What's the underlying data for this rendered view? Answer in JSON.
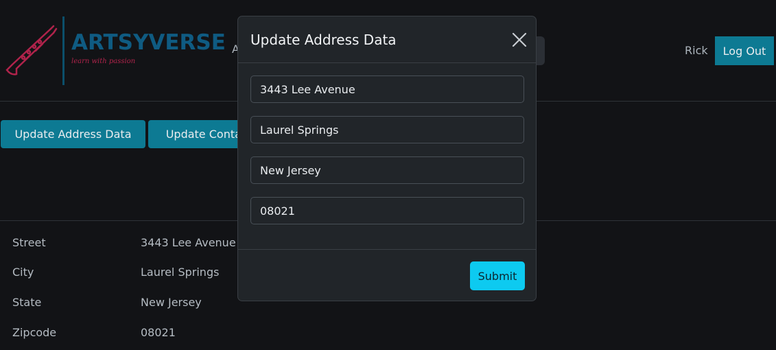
{
  "header": {
    "brand_name": "ARTSYVERSE",
    "brand_tagline": "learn with passion",
    "logo_icon": "clarinet-icon",
    "nav_partial": "A",
    "user_name": "Rick",
    "logout_label": "Log Out"
  },
  "actions": {
    "update_address_label": "Update Address Data",
    "update_contact_label": "Update Contact Data"
  },
  "info": {
    "rows": [
      {
        "label": "Street",
        "value": "3443 Lee Avenue"
      },
      {
        "label": "City",
        "value": "Laurel Springs"
      },
      {
        "label": "State",
        "value": "New Jersey"
      },
      {
        "label": "Zipcode",
        "value": "08021"
      }
    ]
  },
  "modal": {
    "title": "Update Address Data",
    "close_icon": "close-icon",
    "fields": [
      {
        "value": "3443 Lee Avenue"
      },
      {
        "value": "Laurel Springs"
      },
      {
        "value": "New Jersey"
      },
      {
        "value": "08021"
      }
    ],
    "submit_label": "Submit"
  },
  "colors": {
    "background": "#121316",
    "accent_button": "#0d7a93",
    "submit_button": "#0dcaf0",
    "modal_background": "#212529",
    "brand_blue": "#0f5b82",
    "brand_pink": "#b0234b"
  }
}
